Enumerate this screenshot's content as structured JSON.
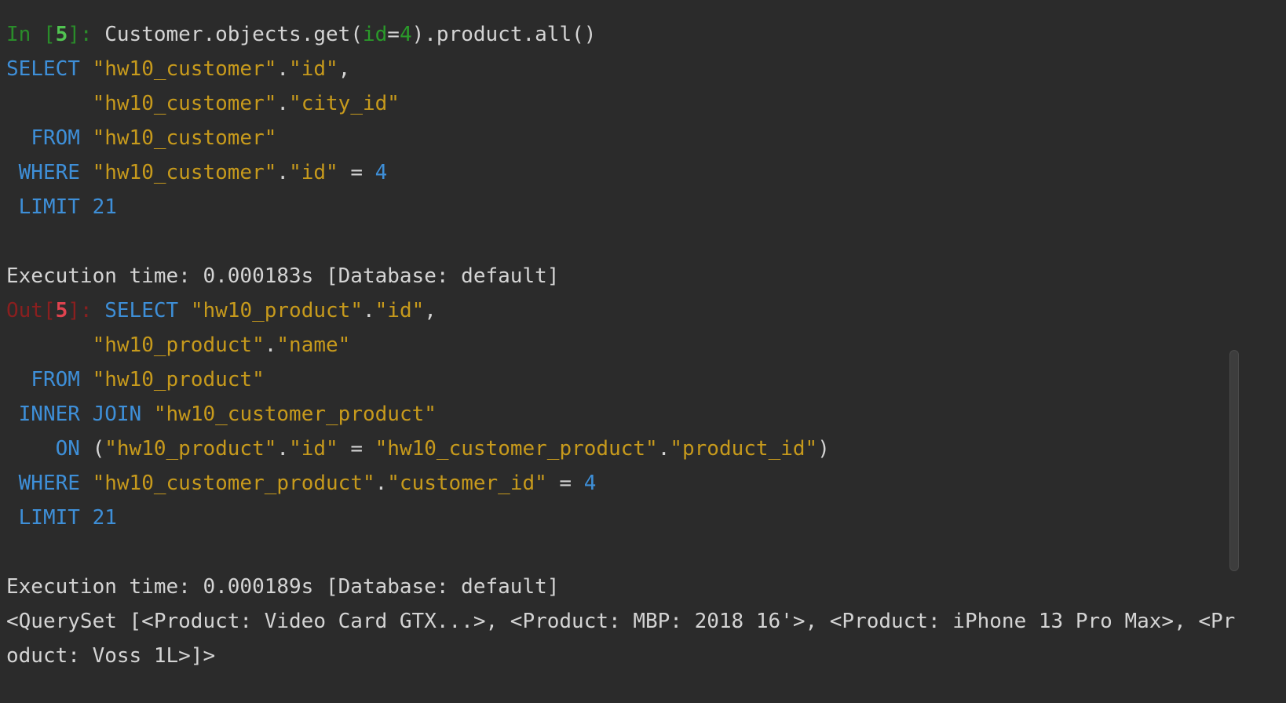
{
  "input": {
    "prompt_in": "In [",
    "cell_number": "5",
    "prompt_close": "]: ",
    "code_prefix": "Customer.objects.get(",
    "arg_name": "id",
    "arg_eq": "=",
    "arg_value": "4",
    "code_suffix": ").product.all()"
  },
  "query1": {
    "select_kw": "SELECT",
    "table": "\"hw10_customer\"",
    "dot": ".",
    "col_id": "\"id\"",
    "comma": ",",
    "col_city": "\"city_id\"",
    "from_kw": "FROM",
    "where_kw": "WHERE",
    "eq": " = ",
    "where_value": "4",
    "limit_kw": "LIMIT",
    "limit_value": "21"
  },
  "exec1": "Execution time: 0.000183s [Database: default]",
  "output": {
    "prompt_out": "Out[",
    "cell_number": "5",
    "prompt_close": "]: "
  },
  "query2": {
    "select_kw": "SELECT",
    "table": "\"hw10_product\"",
    "dot": ".",
    "col_id": "\"id\"",
    "comma": ",",
    "col_name": "\"name\"",
    "from_kw": "FROM",
    "inner_kw": "INNER",
    "join_kw": "JOIN",
    "join_table": "\"hw10_customer_product\"",
    "on_kw": "ON",
    "paren_open": "(",
    "paren_close": ")",
    "col_product_id": "\"product_id\"",
    "col_customer_id": "\"customer_id\"",
    "eq": " = ",
    "where_kw": "WHERE",
    "where_value": "4",
    "limit_kw": "LIMIT",
    "limit_value": "21"
  },
  "exec2": "Execution time: 0.000189s [Database: default]",
  "result_line1": "<QuerySet [<Product: Video Card GTX...>, <Product: MBP: 2018 16'>, <Product: iPhone 13 Pro Max>, <Pr",
  "result_line2": "oduct: Voss 1L>]>"
}
